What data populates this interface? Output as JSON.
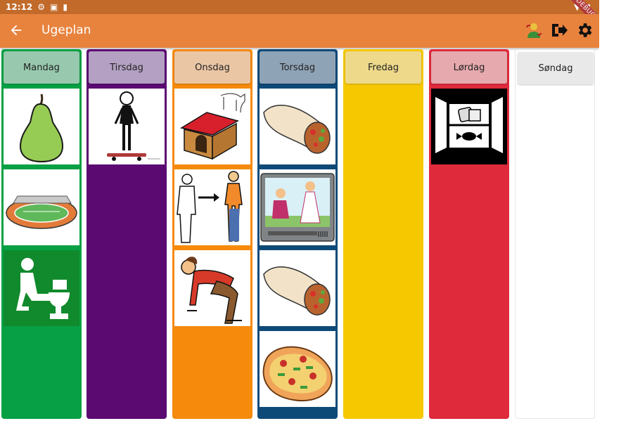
{
  "status_bar": {
    "time": "12:12"
  },
  "debug_banner": "DEBUG",
  "app_bar": {
    "title": "Ugeplan"
  },
  "days": [
    {
      "label": "Mandag",
      "column_color": "#07a044",
      "header_color": "#98c9ae",
      "activities": [
        "pear-pictogram",
        "running-track-pictogram",
        "toilet-pictogram"
      ]
    },
    {
      "label": "Tirsdag",
      "column_color": "#5b0a72",
      "header_color": "#b3a0c2",
      "activities": [
        "skateboard-pictogram"
      ]
    },
    {
      "label": "Onsdag",
      "column_color": "#f58a0c",
      "header_color": "#eac6a5",
      "activities": [
        "doghouse-pictogram",
        "grow-up-pictogram",
        "bend-down-pictogram"
      ]
    },
    {
      "label": "Torsdag",
      "column_color": "#0e4a78",
      "header_color": "#8fa3b6",
      "activities": [
        "burrito-pictogram",
        "tv-pictogram",
        "burrito-pictogram",
        "pizza-pictogram"
      ]
    },
    {
      "label": "Fredag",
      "column_color": "#f6c800",
      "header_color": "#eed98a",
      "activities": []
    },
    {
      "label": "Lørdag",
      "column_color": "#df2a3c",
      "header_color": "#e6a9ae",
      "activities": [
        "treat-cupboard-pictogram"
      ]
    },
    {
      "label": "Søndag",
      "column_color": "#ffffff",
      "header_color": "#e9e9e9",
      "activities": []
    }
  ],
  "colors": {
    "app_bar": "#e8833e",
    "status_bar": "#c26a2a"
  }
}
